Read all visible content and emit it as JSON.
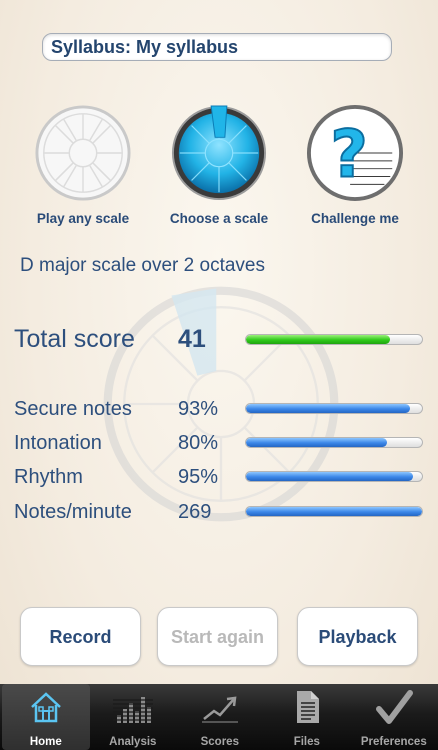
{
  "syllabus": {
    "label": "Syllabus: My syllabus"
  },
  "modes": [
    {
      "label": "Play any scale",
      "icon": "empty-wheel-icon"
    },
    {
      "label": "Choose a scale",
      "icon": "blue-wheel-icon"
    },
    {
      "label": "Challenge me",
      "icon": "question-staff-icon"
    }
  ],
  "scale_title": "D major scale over 2 octaves",
  "total": {
    "label": "Total score",
    "value": "41",
    "fraction": 0.82
  },
  "metrics": [
    {
      "label": "Secure notes",
      "value": "93%",
      "fraction": 0.93
    },
    {
      "label": "Intonation",
      "value": "80%",
      "fraction": 0.8
    },
    {
      "label": "Rhythm",
      "value": "95%",
      "fraction": 0.95
    },
    {
      "label": "Notes/minute",
      "value": "269",
      "fraction": 1.0
    }
  ],
  "buttons": {
    "record": "Record",
    "start_again": "Start again",
    "playback": "Playback"
  },
  "tabs": [
    {
      "label": "Home",
      "icon": "house-icon",
      "active": true
    },
    {
      "label": "Analysis",
      "icon": "bars-icon",
      "active": false
    },
    {
      "label": "Scores",
      "icon": "trend-icon",
      "active": false
    },
    {
      "label": "Files",
      "icon": "document-icon",
      "active": false
    },
    {
      "label": "Preferences",
      "icon": "checkmark-icon",
      "active": false
    }
  ],
  "colors": {
    "text": "#2d4f7d",
    "green_bar": "#2fca1a",
    "blue_bar": "#3b86e8",
    "accent_cyan": "#1fb7e6"
  }
}
